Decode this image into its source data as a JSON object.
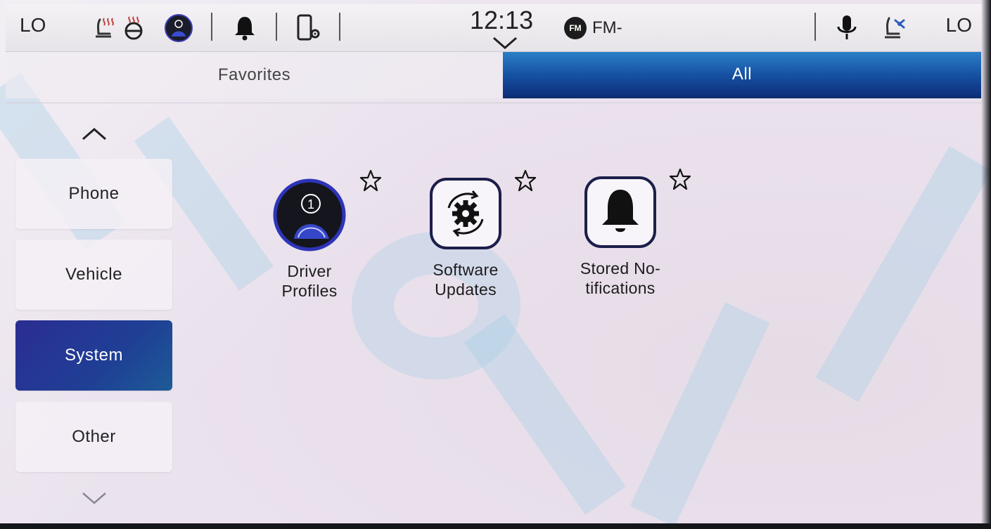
{
  "status_bar": {
    "temp_left": "LO",
    "temp_right": "LO",
    "clock": "12:13",
    "radio_badge": "FM",
    "radio_label": "FM-",
    "icons": [
      "heated-seat-icon",
      "heated-steering-icon",
      "driver-profile-icon",
      "notifications-bell-icon",
      "phone-settings-icon",
      "microphone-icon",
      "seat-fan-icon"
    ]
  },
  "tabs": [
    {
      "label": "Favorites",
      "selected": false
    },
    {
      "label": "All",
      "selected": true
    }
  ],
  "sidebar": {
    "items": [
      {
        "label": "Phone",
        "selected": false
      },
      {
        "label": "Vehicle",
        "selected": false
      },
      {
        "label": "System",
        "selected": true
      },
      {
        "label": "Other",
        "selected": false
      }
    ]
  },
  "apps": [
    {
      "label": "Driver\nProfiles",
      "icon": "driver-profile-icon",
      "favorite": false
    },
    {
      "label": "Software\nUpdates",
      "icon": "software-update-icon",
      "favorite": false
    },
    {
      "label": "Stored No-\ntifications",
      "icon": "bell-icon",
      "favorite": false
    }
  ],
  "colors": {
    "accent_blue": "#154fa0",
    "selected_sidebar": "#2b2d92",
    "background": "#ebe4ee"
  }
}
